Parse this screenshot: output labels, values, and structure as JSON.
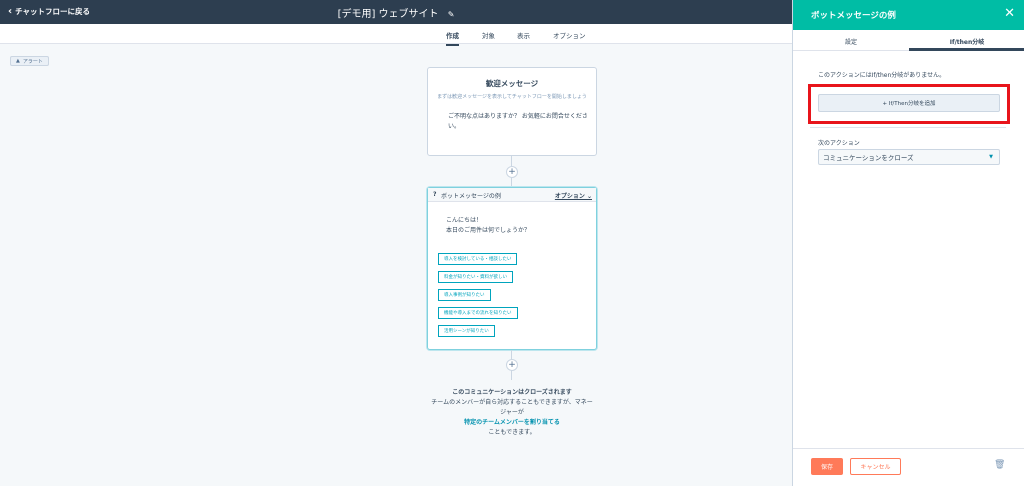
{
  "topbar": {
    "back_label": "チャットフローに戻る",
    "title": "[デモ用] ウェブサイト"
  },
  "tabs": [
    {
      "label": "作成",
      "active": true
    },
    {
      "label": "対象",
      "active": false
    },
    {
      "label": "表示",
      "active": false
    },
    {
      "label": "オプション",
      "active": false
    }
  ],
  "alert_badge": "アラート",
  "welcome_card": {
    "title": "歓迎メッセージ",
    "subtitle": "まずは歓迎メッセージを表示してチャットフローを開始しましょう",
    "body": "ご不明な点はありますか？ お気軽にお問合せください。"
  },
  "bot_card": {
    "question_mark": "?",
    "name": "ボットメッセージの例",
    "options_label": "オプション ⌄",
    "message_line1": "こんにちは！",
    "message_line2": "本日のご用件は何でしょうか？",
    "choices": [
      "導入を検討している・相談したい",
      "料金が知りたい・資料が欲しい",
      "導入事例が知りたい",
      "機能や導入までの流れを知りたい",
      "活用シーンが知りたい"
    ]
  },
  "closing": {
    "line1": "このコミュニケーションはクローズされます",
    "line2": "チームのメンバーが自ら対応することもできますが、マネージャーが",
    "link": "特定のチームメンバーを割り当てる",
    "line3": "こともできます。"
  },
  "panel": {
    "title": "ボットメッセージの例",
    "tab_settings": "設定",
    "tab_ifthen": "If/then分岐",
    "no_ifthen_text": "このアクションにはIf/then分岐がありません。",
    "add_button": "+  If/Then分岐を追加",
    "next_action_label": "次のアクション",
    "next_action_value": "コミュニケーションをクローズ",
    "save_label": "保存",
    "cancel_label": "キャンセル"
  },
  "colors": {
    "topbar": "#2d3e50",
    "panel_header": "#00bda5",
    "accent_teal": "#00a4bd",
    "save_orange": "#ff7a59",
    "highlight_red": "#e8141b"
  },
  "icons": [
    "chevron-left-icon",
    "pencil-icon",
    "warning-icon",
    "plus-icon",
    "close-icon",
    "caret-down-icon",
    "trash-icon"
  ]
}
